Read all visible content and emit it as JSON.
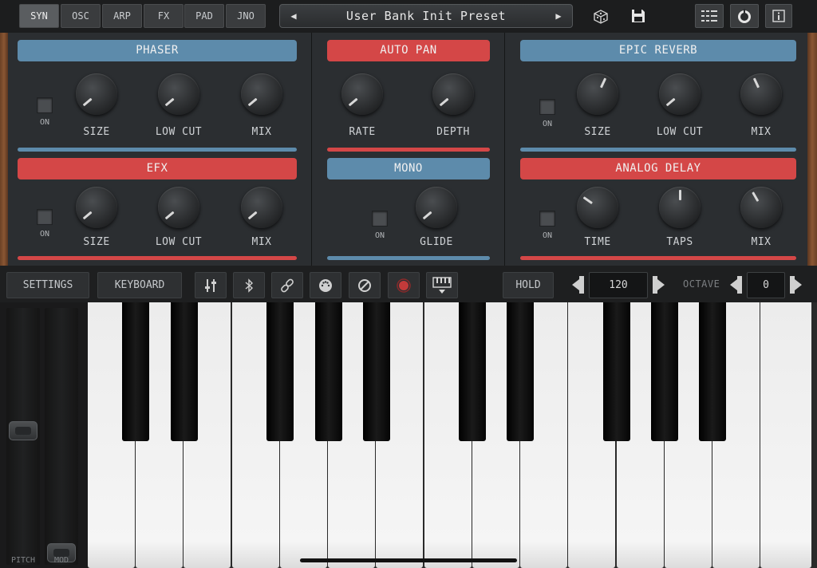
{
  "tabs": [
    "SYN",
    "OSC",
    "ARP",
    "FX",
    "PAD",
    "JNO"
  ],
  "active_tab": "SYN",
  "preset": {
    "name": "User Bank Init Preset",
    "prev": "◀",
    "next": "▶"
  },
  "top_icons": [
    "dice-icon",
    "save-icon",
    "grid-menu-icon",
    "record-knob-icon",
    "info-icon"
  ],
  "fx": {
    "phaser": {
      "title": "PHASER",
      "on": "ON",
      "knobs": [
        "SIZE",
        "LOW CUT",
        "MIX"
      ]
    },
    "auto_pan": {
      "title": "AUTO PAN",
      "knobs": [
        "RATE",
        "DEPTH"
      ]
    },
    "epic_reverb": {
      "title": "EPIC REVERB",
      "on": "ON",
      "knobs": [
        "SIZE",
        "LOW CUT",
        "MIX"
      ]
    },
    "efx": {
      "title": "EFX",
      "on": "ON",
      "knobs": [
        "SIZE",
        "LOW CUT",
        "MIX"
      ]
    },
    "mono": {
      "title": "MONO",
      "on": "ON",
      "knobs": [
        "GLIDE"
      ]
    },
    "analog_delay": {
      "title": "ANALOG DELAY",
      "on": "ON",
      "knobs": [
        "TIME",
        "TAPS",
        "MIX"
      ]
    }
  },
  "controls": {
    "settings": "SETTINGS",
    "keyboard": "KEYBOARD",
    "hold": "HOLD",
    "tempo": "120",
    "octave_label": "OCTAVE",
    "octave": "0",
    "icons": [
      "sliders-icon",
      "bluetooth-icon",
      "link-icon",
      "midi-icon",
      "disable-icon",
      "record-icon",
      "keyboard-layout-icon"
    ]
  },
  "wheels": {
    "pitch": "PITCH",
    "mod": "MOD"
  },
  "colors": {
    "blue": "#5d8bab",
    "red": "#d44747",
    "panel": "#2b2e31"
  }
}
